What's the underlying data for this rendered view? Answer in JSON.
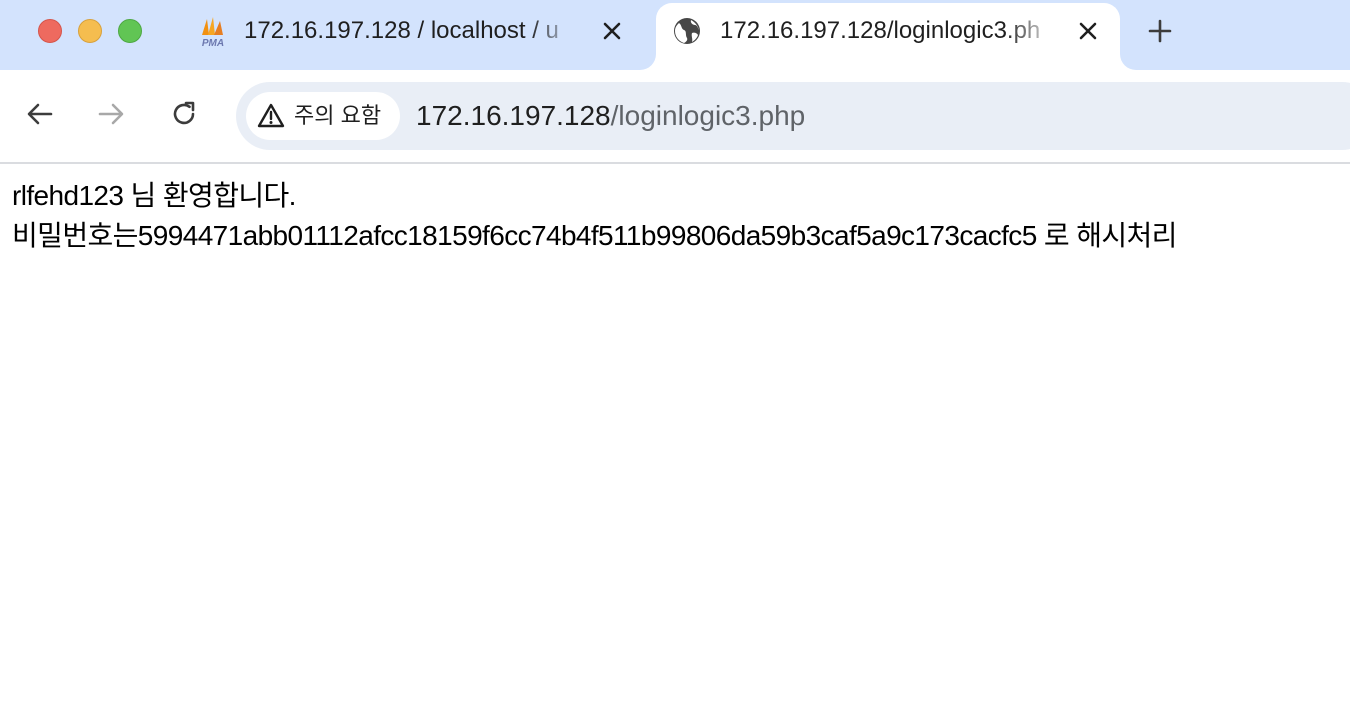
{
  "window_controls": {
    "close": "close",
    "minimize": "minimize",
    "zoom": "zoom"
  },
  "tabs": [
    {
      "title": "172.16.197.128 / localhost / u",
      "favicon": "phpmyadmin-logo",
      "favicon_label": "PMA",
      "active": false
    },
    {
      "title": "172.16.197.128/loginlogic3.ph",
      "favicon": "globe-icon",
      "active": true
    }
  ],
  "toolbar": {
    "back_icon": "arrow-left-icon",
    "forward_icon": "arrow-right-icon",
    "reload_icon": "reload-icon",
    "security_chip_label": "주의 요함",
    "url_host": "172.16.197.128",
    "url_path": "/loginlogic3.php"
  },
  "page": {
    "line1": "rlfehd123 님 환영합니다.",
    "line2": "비밀번호는5994471abb01112afcc18159f6cc74b4f511b99806da59b3caf5a9c173cacfc5 로 해시처리"
  },
  "colors": {
    "tabstrip_bg": "#d3e3fd",
    "omnibox_bg": "#e9eef6",
    "close_red": "#ee6a5f",
    "minimize_yellow": "#f5bd4f",
    "zoom_green": "#61c554"
  }
}
